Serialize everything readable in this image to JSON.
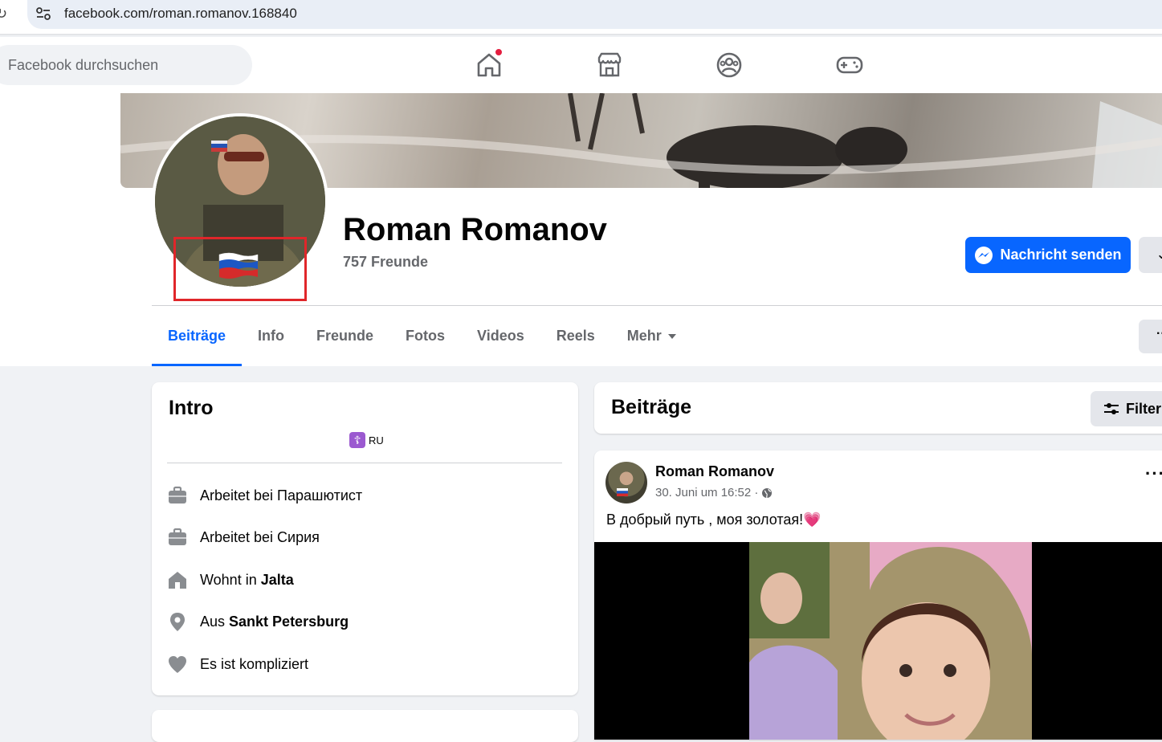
{
  "browser": {
    "url": "facebook.com/roman.romanov.168840"
  },
  "nav": {
    "search_placeholder": "Facebook durchsuchen",
    "icons": [
      "home-icon",
      "marketplace-icon",
      "groups-icon",
      "gaming-icon"
    ]
  },
  "profile": {
    "name": "Roman Romanov",
    "friends": "757 Freunde",
    "message_button": "Nachricht senden",
    "more_button": "⌄",
    "tabs_more_button": "··"
  },
  "tabs": {
    "items": [
      "Beiträge",
      "Info",
      "Freunde",
      "Fotos",
      "Videos",
      "Reels",
      "Mehr"
    ],
    "active": "Beiträge"
  },
  "intro": {
    "title": "Intro",
    "bio_emoji": "☦",
    "bio_text": "RU",
    "items": [
      {
        "icon": "briefcase-icon",
        "prefix": "Arbeitet bei Парашютист",
        "bold": ""
      },
      {
        "icon": "briefcase-icon",
        "prefix": "Arbeitet bei Сирия",
        "bold": ""
      },
      {
        "icon": "home-icon",
        "prefix": "Wohnt in",
        "bold": "Jalta"
      },
      {
        "icon": "location-pin-icon",
        "prefix": "Aus",
        "bold": "Sankt Petersburg"
      },
      {
        "icon": "heart-icon",
        "prefix": "Es ist kompliziert",
        "bold": ""
      }
    ]
  },
  "posts": {
    "title": "Beiträge",
    "filter_label": "Filter",
    "post": {
      "author": "Roman Romanov",
      "date": "30. Juni um 16:52 ·",
      "text": "В добрый путь , моя золотая!",
      "text_emoji": "💗",
      "options": "···"
    }
  },
  "colors": {
    "accent": "#0866ff",
    "highlight": "#e0262a",
    "notification": "#e41e3f"
  }
}
